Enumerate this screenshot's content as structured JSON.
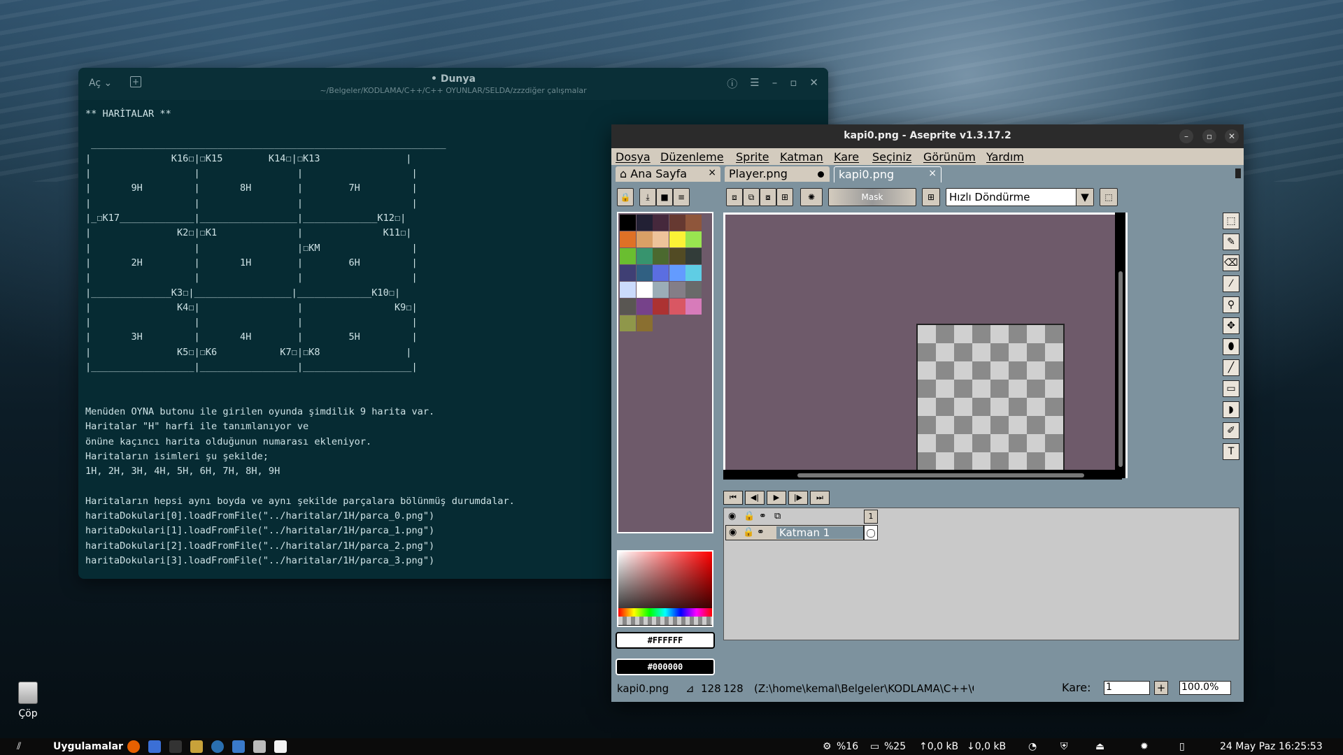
{
  "editor": {
    "open_label": "Aç ⌄",
    "title": "• Dunya",
    "path": "~/Belgeler/KODLAMA/C++/C++ OYUNLAR/SELDA/zzzdiğer çalışmalar",
    "content": "** HARİTALAR **\n\n ______________________________________________________________\n|              K16☐|☐K15        K14☐|☐K13               |\n|                  |                 |                   |\n|       9H         |       8H        |        7H         |\n|                  |                 |                   |\n|_☐K17_____________|_________________|_____________K12☐|\n|               K2☐|☐K1              |              K11☐|\n|                  |                 |☐KM                |\n|       2H         |       1H        |        6H         |\n|                  |                 |                   |\n|______________K3☐|_________________|_____________K10☐|\n|               K4☐|                 |                K9☐|\n|                  |                 |                   |\n|       3H         |       4H        |        5H         |\n|               K5☐|☐K6           K7☐|☐K8               |\n|__________________|_________________|___________________|\n\n\nMenüden OYNA butonu ile girilen oyunda şimdilik 9 harita var.\nHaritalar \"H\" harfi ile tanımlanıyor ve\nönüne kaçıncı harita olduğunun numarası ekleniyor.\nHaritaların isimleri şu şekilde;\n1H, 2H, 3H, 4H, 5H, 6H, 7H, 8H, 9H\n\nHaritaların hepsi aynı boyda ve aynı şekilde parçalara bölünmüş durumdalar.\nharitaDokulari[0].loadFromFile(\"../haritalar/1H/parca_0.png\")\nharitaDokulari[1].loadFromFile(\"../haritalar/1H/parca_1.png\")\nharitaDokulari[2].loadFromFile(\"../haritalar/1H/parca_2.png\")\nharitaDokulari[3].loadFromFile(\"../haritalar/1H/parca_3.png\")"
  },
  "aseprite": {
    "title": "kapi0.png - Aseprite v1.3.17.2",
    "menu": [
      "Dosya",
      "Düzenleme",
      "Sprite",
      "Katman",
      "Kare",
      "Seçiniz",
      "Görünüm",
      "Yardım"
    ],
    "tabs": [
      {
        "label": "Ana Sayfa",
        "close": "×"
      },
      {
        "label": "Player.png"
      },
      {
        "label": "kapi0.png",
        "close": "×"
      }
    ],
    "mask_label": "Mask",
    "rotation_select": "Hızlı Döndürme",
    "fg_color": "#FFFFFF",
    "bg_color": "#000000",
    "palette": [
      "#000000",
      "#222034",
      "#45283c",
      "#663931",
      "#8f563b",
      "#df7126",
      "#d9a066",
      "#eec39a",
      "#fbf236",
      "#99e550",
      "#6abe30",
      "#37946e",
      "#4b692f",
      "#524b24",
      "#323c39",
      "#3f3f74",
      "#306082",
      "#5b6ee1",
      "#639bff",
      "#5fcde4",
      "#cbdbfc",
      "#ffffff",
      "#9badb7",
      "#847e87",
      "#696a6a",
      "#595652",
      "#76428a",
      "#ac3232",
      "#d95763",
      "#d77bba",
      "#8f974a",
      "#8a6f30"
    ],
    "layer_name": "Katman 1",
    "frame_number": "1",
    "status": {
      "filename": "kapi0.png",
      "size_w": "128",
      "size_h": "128",
      "path": "(Z:\\home\\kemal\\Belgeler\\KODLAMA\\C++\\C++ OYUNI",
      "frame_label": "Kare:",
      "frame_value": "1",
      "zoom": "100.0%"
    }
  },
  "desktop": {
    "trash_label": "Çöp"
  },
  "taskbar": {
    "apps_label": "Uygulamalar",
    "cpu": "%16",
    "mem": "%25",
    "up": "↑0,0 kB",
    "down": "↓0,0 kB",
    "datetime": "24 May Paz  16:25:53"
  }
}
